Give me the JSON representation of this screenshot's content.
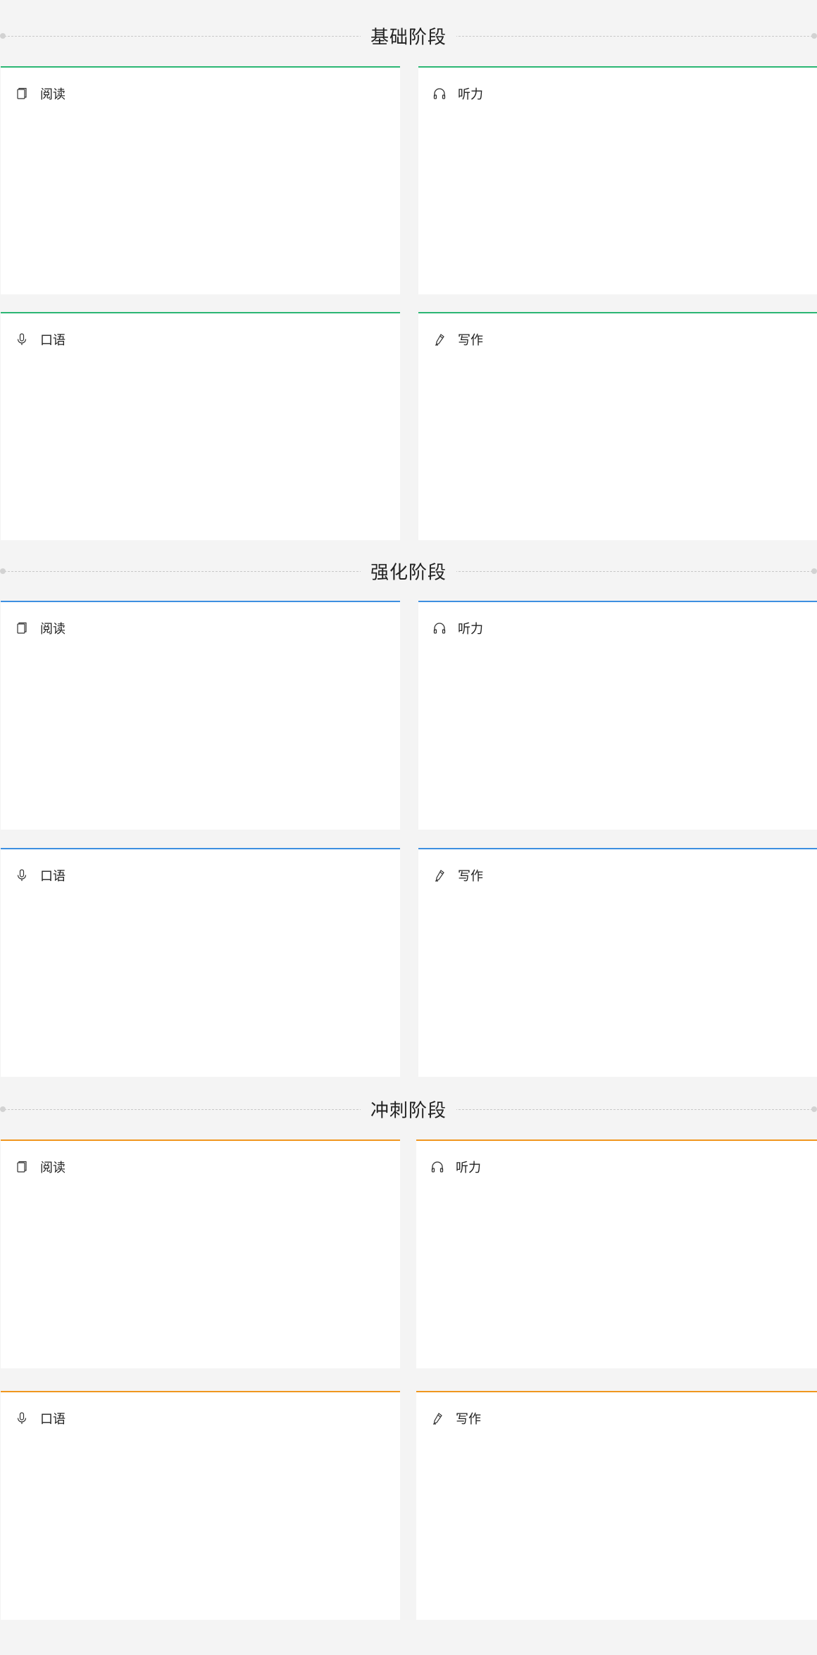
{
  "stages": [
    {
      "title": "基础阶段",
      "cards": [
        {
          "label": "阅读",
          "icon": "book-icon"
        },
        {
          "label": "听力",
          "icon": "headphones-icon"
        },
        {
          "label": "口语",
          "icon": "microphone-icon"
        },
        {
          "label": "写作",
          "icon": "pen-icon"
        }
      ],
      "accent": "#2bb673"
    },
    {
      "title": "强化阶段",
      "cards": [
        {
          "label": "阅读",
          "icon": "book-icon"
        },
        {
          "label": "听力",
          "icon": "headphones-icon"
        },
        {
          "label": "口语",
          "icon": "microphone-icon"
        },
        {
          "label": "写作",
          "icon": "pen-icon"
        }
      ],
      "accent": "#3d8fe0"
    },
    {
      "title": "冲刺阶段",
      "cards": [
        {
          "label": "阅读",
          "icon": "book-icon"
        },
        {
          "label": "听力",
          "icon": "headphones-icon"
        },
        {
          "label": "口语",
          "icon": "microphone-icon"
        },
        {
          "label": "写作",
          "icon": "pen-icon"
        }
      ],
      "accent": "#f0961e"
    }
  ]
}
